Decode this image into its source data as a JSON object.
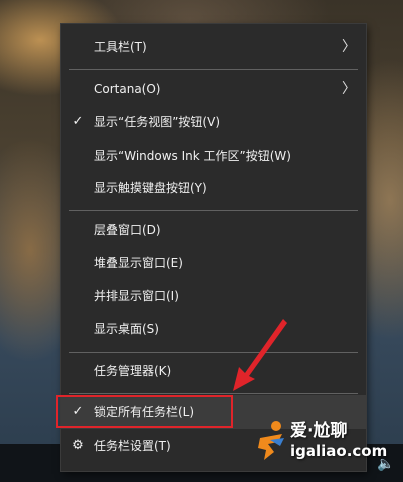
{
  "context_menu": {
    "items": [
      {
        "label": "工具栏(T)",
        "submenu": true,
        "checked": false
      },
      {
        "label": "Cortana(O)",
        "submenu": true,
        "checked": false
      },
      {
        "label": "显示“任务视图”按钮(V)",
        "submenu": false,
        "checked": true
      },
      {
        "label": "显示“Windows Ink 工作区”按钮(W)",
        "submenu": false,
        "checked": false
      },
      {
        "label": "显示触摸键盘按钮(Y)",
        "submenu": false,
        "checked": false
      },
      {
        "label": "层叠窗口(D)",
        "submenu": false,
        "checked": false
      },
      {
        "label": "堆叠显示窗口(E)",
        "submenu": false,
        "checked": false
      },
      {
        "label": "并排显示窗口(I)",
        "submenu": false,
        "checked": false
      },
      {
        "label": "显示桌面(S)",
        "submenu": false,
        "checked": false
      },
      {
        "label": "任务管理器(K)",
        "submenu": false,
        "checked": false
      },
      {
        "label": "锁定所有任务栏(L)",
        "submenu": false,
        "checked": true,
        "highlighted": true
      },
      {
        "label": "任务栏设置(T)",
        "submenu": false,
        "checked": false,
        "icon": "gear-icon"
      }
    ],
    "check_glyph": "✓",
    "arrow_glyph": "〉",
    "gear_glyph": "⚙"
  },
  "watermark": {
    "line1": "爱·尬聊",
    "line2": "igaliao.com"
  },
  "tray": {
    "speaker_icon": "speaker-icon",
    "speaker_glyph": "🔈"
  },
  "colors": {
    "menu_bg": "#2b2b2b",
    "highlight_box": "#e0242a",
    "text": "#f0f0f0"
  }
}
